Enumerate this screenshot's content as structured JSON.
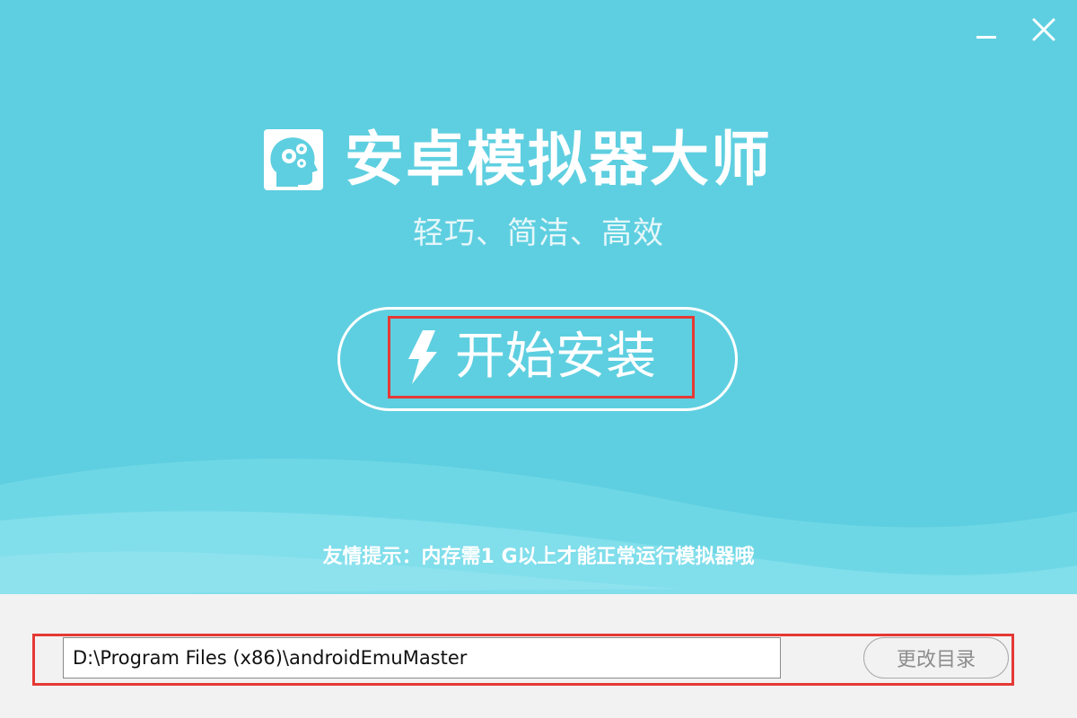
{
  "window": {
    "minimize_icon": "minimize-icon",
    "close_icon": "close-icon"
  },
  "header": {
    "logo_icon": "head-gears-icon",
    "title": "安卓模拟器大师",
    "tagline": "轻巧、简洁、高效"
  },
  "install": {
    "label": "开始安装",
    "icon": "lightning-bolt-icon"
  },
  "tip": "友情提示：内存需1 G以上才能正常运行模拟器哦",
  "path": {
    "value": "D:\\Program Files (x86)\\androidEmuMaster",
    "change_label": "更改目录"
  },
  "colors": {
    "primary_bg": "#5ecfe0",
    "bottom_bg": "#f2f2f2",
    "highlight_border": "#e53935",
    "text_white": "#ffffff"
  }
}
